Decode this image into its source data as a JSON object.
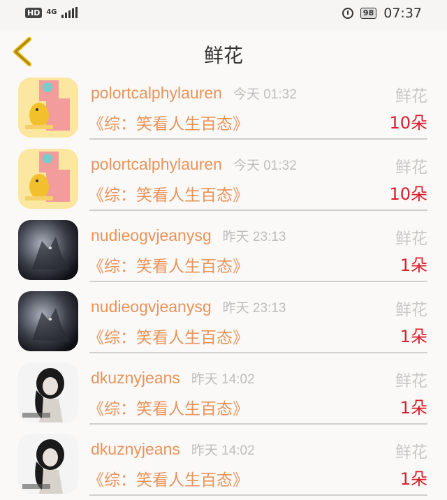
{
  "status_bar": {
    "hd": "HD",
    "network": "4G",
    "battery": "98",
    "time": "07:37"
  },
  "header": {
    "title": "鲜花",
    "back_icon": "chevron-left-icon"
  },
  "colors": {
    "username": "#e8945a",
    "count": "#d8202c",
    "muted": "#bdbdbd",
    "back_icon": "#e8b400"
  },
  "items": [
    {
      "avatar": "cartoon-avatar",
      "username": "polortcalphylauren",
      "time": "今天 01:32",
      "label": "鲜花",
      "book": "《综：笑看人生百态》",
      "count": "10朵"
    },
    {
      "avatar": "cartoon-avatar",
      "username": "polortcalphylauren",
      "time": "今天 01:32",
      "label": "鲜花",
      "book": "《综：笑看人生百态》",
      "count": "10朵"
    },
    {
      "avatar": "wolf-avatar",
      "username": "nudieogvjeanysg",
      "time": "昨天 23:13",
      "label": "鲜花",
      "book": "《综：笑看人生百态》",
      "count": "1朵"
    },
    {
      "avatar": "wolf-avatar",
      "username": "nudieogvjeanysg",
      "time": "昨天 23:13",
      "label": "鲜花",
      "book": "《综：笑看人生百态》",
      "count": "1朵"
    },
    {
      "avatar": "portrait-avatar",
      "username": "dkuznyjeans",
      "time": "昨天 14:02",
      "label": "鲜花",
      "book": "《综：笑看人生百态》",
      "count": "1朵"
    },
    {
      "avatar": "portrait-avatar",
      "username": "dkuznyjeans",
      "time": "昨天 14:02",
      "label": "鲜花",
      "book": "《综：笑看人生百态》",
      "count": "1朵"
    }
  ]
}
